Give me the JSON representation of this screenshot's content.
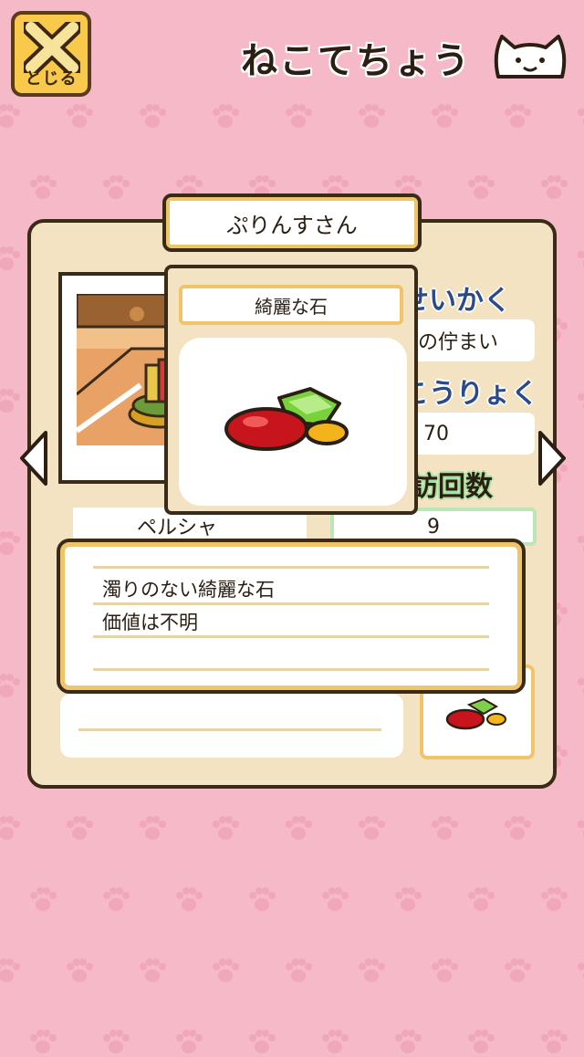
{
  "header": {
    "close_label": "とじる",
    "title": "ねこてちょう",
    "close_icon": "x-icon",
    "cat_icon": "cat-face-icon"
  },
  "profile": {
    "cat_name": "ぷりんすさん",
    "personality_label": "せいかく",
    "personality_value": "の佇まい",
    "power_label": "こうりょく",
    "power_value": "70",
    "visits_label": "来訪回数",
    "visits_value": "9",
    "breed": "ペルシャ"
  },
  "gift_popup": {
    "title": "綺麗な石",
    "description_lines": [
      "濁りのない綺麗な石",
      "価値は不明"
    ]
  },
  "navigation": {
    "prev_icon": "chevron-left-icon",
    "next_icon": "chevron-right-icon"
  },
  "colors": {
    "background": "#f5b9c8",
    "card": "#f4e3c2",
    "accent": "#f0c56a",
    "stat_label": "#2a4a8a"
  }
}
